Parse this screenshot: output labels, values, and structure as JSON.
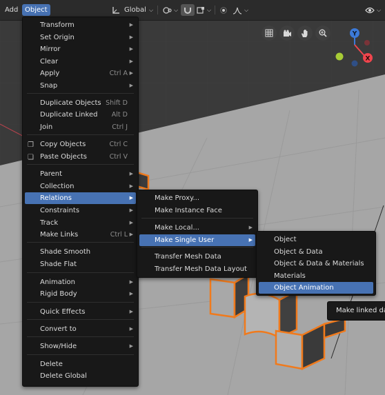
{
  "header": {
    "add_label": "Add",
    "object_label": "Object",
    "orientation_icon": "transform-orientation-icon",
    "orientation_label": "Global",
    "pivot_icon": "pivot-point-icon",
    "snap_icon": "snap-magnet-icon",
    "proportional_icon": "proportional-edit-icon",
    "falloff_icon": "falloff-curve-icon",
    "visibility_icon": "eye-icon"
  },
  "nav_buttons": [
    "grid-view-icon",
    "camera-icon",
    "hand-pan-icon",
    "zoom-icon"
  ],
  "gizmo": {
    "y_label": "Y",
    "x_label": "X",
    "x_color": "#f0454d",
    "y_color": "#65a526",
    "z_color": "#3c7ad8"
  },
  "object_menu": [
    {
      "label": "Transform",
      "shortcut": "",
      "submenu": true
    },
    {
      "label": "Set Origin",
      "shortcut": "",
      "submenu": true
    },
    {
      "label": "Mirror",
      "shortcut": "",
      "submenu": true
    },
    {
      "label": "Clear",
      "shortcut": "",
      "submenu": true
    },
    {
      "label": "Apply",
      "shortcut": "Ctrl A",
      "submenu": true
    },
    {
      "label": "Snap",
      "shortcut": "",
      "submenu": true
    },
    {
      "label": "Duplicate Objects",
      "shortcut": "Shift D",
      "submenu": false
    },
    {
      "label": "Duplicate Linked",
      "shortcut": "Alt D",
      "submenu": false
    },
    {
      "label": "Join",
      "shortcut": "Ctrl J",
      "submenu": false
    },
    {
      "label": "Copy Objects",
      "shortcut": "Ctrl C",
      "submenu": false,
      "icon": "copy-icon"
    },
    {
      "label": "Paste Objects",
      "shortcut": "Ctrl V",
      "submenu": false,
      "icon": "paste-icon"
    },
    {
      "label": "Parent",
      "shortcut": "",
      "submenu": true
    },
    {
      "label": "Collection",
      "shortcut": "",
      "submenu": true
    },
    {
      "label": "Relations",
      "shortcut": "",
      "submenu": true
    },
    {
      "label": "Constraints",
      "shortcut": "",
      "submenu": true
    },
    {
      "label": "Track",
      "shortcut": "",
      "submenu": true
    },
    {
      "label": "Make Links",
      "shortcut": "Ctrl L",
      "submenu": true
    },
    {
      "label": "Shade Smooth",
      "shortcut": "",
      "submenu": false
    },
    {
      "label": "Shade Flat",
      "shortcut": "",
      "submenu": false
    },
    {
      "label": "Animation",
      "shortcut": "",
      "submenu": true
    },
    {
      "label": "Rigid Body",
      "shortcut": "",
      "submenu": true
    },
    {
      "label": "Quick Effects",
      "shortcut": "",
      "submenu": true
    },
    {
      "label": "Convert to",
      "shortcut": "",
      "submenu": true
    },
    {
      "label": "Show/Hide",
      "shortcut": "",
      "submenu": true
    },
    {
      "label": "Delete",
      "shortcut": "",
      "submenu": false
    },
    {
      "label": "Delete Global",
      "shortcut": "",
      "submenu": false
    }
  ],
  "relations_menu": [
    {
      "label": "Make Proxy...",
      "submenu": false
    },
    {
      "label": "Make Instance Face",
      "submenu": false
    },
    {
      "label": "Make Local...",
      "submenu": true
    },
    {
      "label": "Make Single User",
      "submenu": true
    },
    {
      "label": "Transfer Mesh Data",
      "submenu": false
    },
    {
      "label": "Transfer Mesh Data Layout",
      "submenu": false
    }
  ],
  "single_user_menu": [
    {
      "label": "Object"
    },
    {
      "label": "Object & Data"
    },
    {
      "label": "Object & Data & Materials"
    },
    {
      "label": "Materials"
    },
    {
      "label": "Object Animation"
    }
  ],
  "tooltip": {
    "text": "Make linked dat"
  }
}
